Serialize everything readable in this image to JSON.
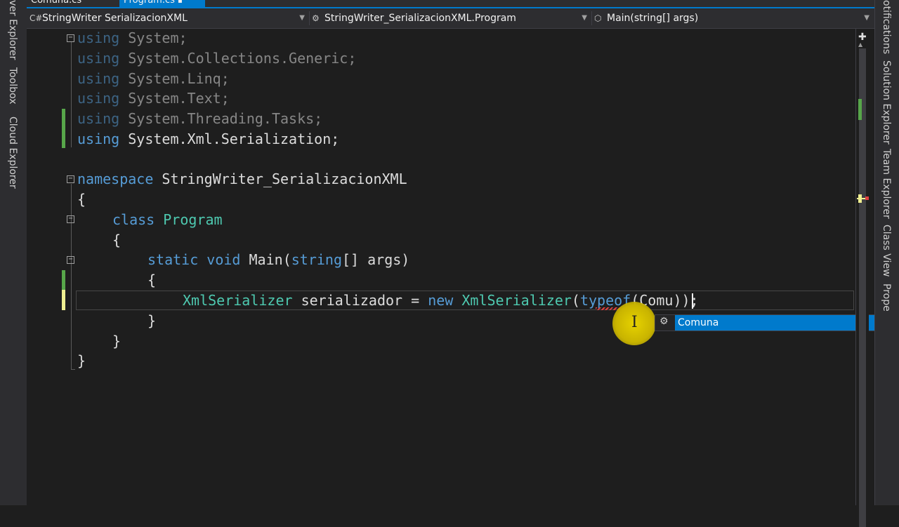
{
  "left_toolbar": {
    "items": [
      "ver Explorer",
      "Toolbox",
      "Cloud Explorer"
    ]
  },
  "right_toolbar": {
    "items": [
      "otifications",
      "Solution Explorer",
      "Team Explorer",
      "Class View",
      "Prope"
    ]
  },
  "tabs": [
    {
      "label": "Comuna.cs",
      "active": false
    },
    {
      "label": "Program.cs",
      "active": true,
      "pinned_icon": "pin-icon",
      "close_icon": "close-icon"
    }
  ],
  "navigation": {
    "project": "StringWriter SerializacionXML",
    "class": "StringWriter_SerializacionXML.Program",
    "member": "Main(string[] args)"
  },
  "code": {
    "usings": [
      {
        "kw": "using",
        "ns": "System;",
        "used": false
      },
      {
        "kw": "using",
        "ns": "System.Collections.Generic;",
        "used": false
      },
      {
        "kw": "using",
        "ns": "System.Linq;",
        "used": false
      },
      {
        "kw": "using",
        "ns": "System.Text;",
        "used": false
      },
      {
        "kw": "using",
        "ns": "System.Threading.Tasks;",
        "used": false
      },
      {
        "kw": "using",
        "ns": "System.Xml.Serialization;",
        "used": true
      }
    ],
    "namespace_kw": "namespace",
    "namespace_name": "StringWriter_SerializacionXML",
    "open_brace": "{",
    "close_brace": "}",
    "class_kw": "class",
    "class_name": "Program",
    "static_kw": "static",
    "void_kw": "void",
    "method_name": "Main",
    "param_open": "(",
    "string_kw": "string",
    "param_rest": "[] args)",
    "stmt": {
      "type": "XmlSerializer",
      "var": " serializador = ",
      "new_kw": "new",
      "sp": " ",
      "type2": "XmlSerializer",
      "paren": "(",
      "typeof_kw": "typeof",
      "arg": "(Comu",
      "end": "));"
    }
  },
  "completion": {
    "icon": "class-icon",
    "item": "Comuna"
  },
  "colors": {
    "keyword": "#569cd6",
    "type": "#4ec9b0",
    "text": "#dcdcdc",
    "accent": "#007acc",
    "saved_change": "#57a64a",
    "unsaved_change": "#efef91"
  }
}
